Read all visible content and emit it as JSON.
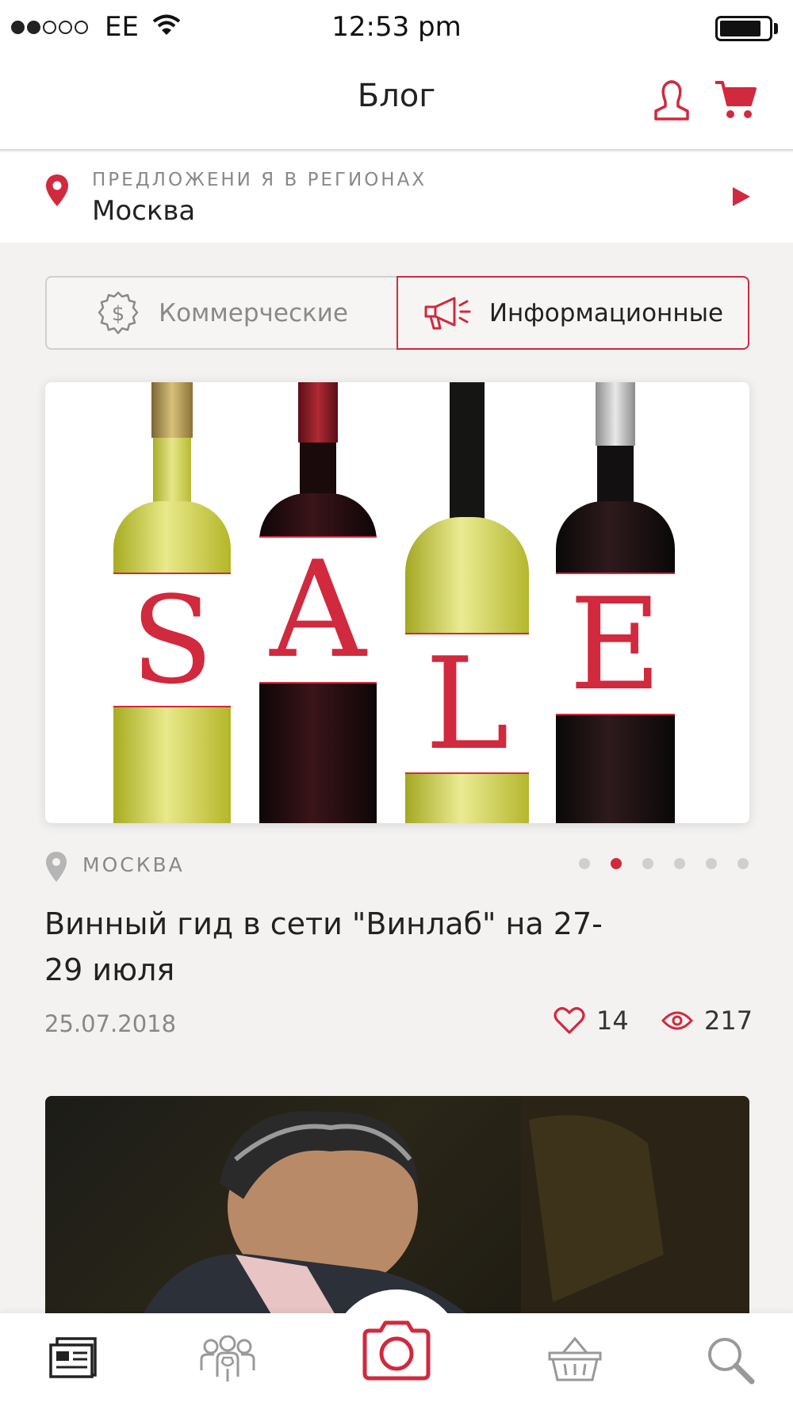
{
  "status_bar": {
    "carrier": "EE",
    "time": "12:53 pm"
  },
  "nav": {
    "title": "Блог"
  },
  "region": {
    "caption": "ПРЕДЛОЖЕНИ Я В РЕГИОНАХ",
    "value": "Москва"
  },
  "segments": [
    {
      "label": "Коммерческие",
      "icon": "dollar-badge-icon",
      "active": false
    },
    {
      "label": "Информационные",
      "icon": "megaphone-icon",
      "active": true
    }
  ],
  "card": {
    "image_letters": [
      "S",
      "A",
      "L",
      "E"
    ],
    "city": "МОСКВА",
    "title": "Винный гид в сети \"Винлаб\" на 27-29 июля",
    "date": "25.07.2018",
    "likes": "14",
    "views": "217",
    "pager_total": 6,
    "pager_active": 2
  },
  "tabs": [
    {
      "icon": "news-icon"
    },
    {
      "icon": "people-icon"
    },
    {
      "icon": "camera-icon"
    },
    {
      "icon": "basket-icon"
    },
    {
      "icon": "search-icon"
    }
  ],
  "colors": {
    "accent": "#d1293d",
    "background": "#f3f2f1",
    "muted": "#888888"
  }
}
